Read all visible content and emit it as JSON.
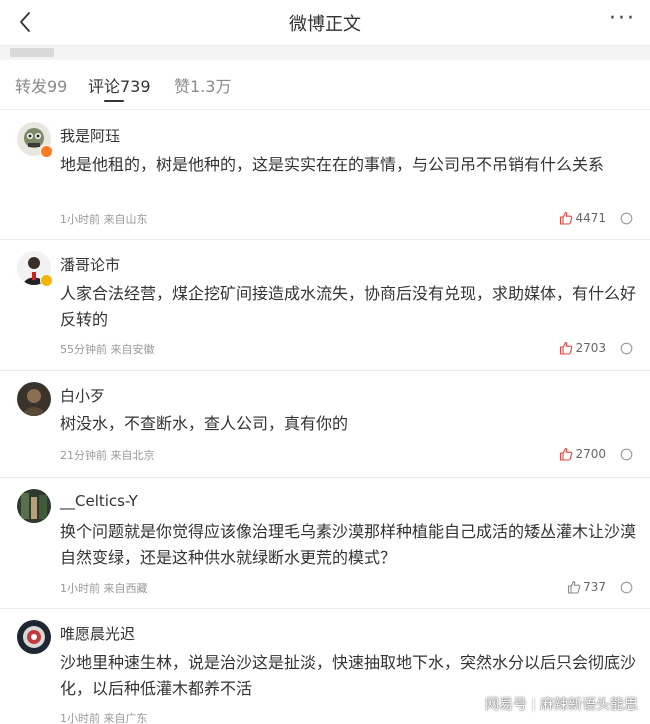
{
  "header": {
    "title": "微博正文",
    "more_label": "···"
  },
  "tabs": [
    {
      "label": "转发99"
    },
    {
      "label": "评论739"
    },
    {
      "label": "赞1.3万"
    }
  ],
  "colors": {
    "like_red": "#e4473f",
    "gold_badge": "#f3b300",
    "orange_badge": "#ff7a20"
  },
  "comments": [
    {
      "name": "我是阿珏",
      "text": "地是他租的，树是他种的，这是实实在在的事情，与公司吊不吊销有什么关系",
      "meta": "1小时前 来自山东",
      "likes": "4471"
    },
    {
      "name": "潘哥论市",
      "text": "人家合法经营，煤企挖矿间接造成水流失，协商后没有兑现，求助媒体，有什么好反转的",
      "meta": "55分钟前 来自安徽",
      "likes": "2703"
    },
    {
      "name": "白小歹",
      "text": "树没水，不查断水，查人公司，真有你的",
      "meta": "21分钟前 来自北京",
      "likes": "2700"
    },
    {
      "name": "__Celtics-Y",
      "text": "换个问题就是你觉得应该像治理毛乌素沙漠那样种植能自己成活的矮丛灌木让沙漠自然变绿，还是这种供水就绿断水更荒的模式？",
      "meta": "1小时前 来自西藏",
      "likes": "737"
    },
    {
      "name": "唯愿晨光迟",
      "text": "沙地里种速生林，说是治沙这是扯淡，快速抽取地下水，突然水分以后只会彻底沙化，以后种低灌木都养不活",
      "meta": "1小时前 来自广东",
      "likes": ""
    }
  ],
  "watermark": {
    "brand": "网易号",
    "account": "麻辣新语头能思"
  }
}
